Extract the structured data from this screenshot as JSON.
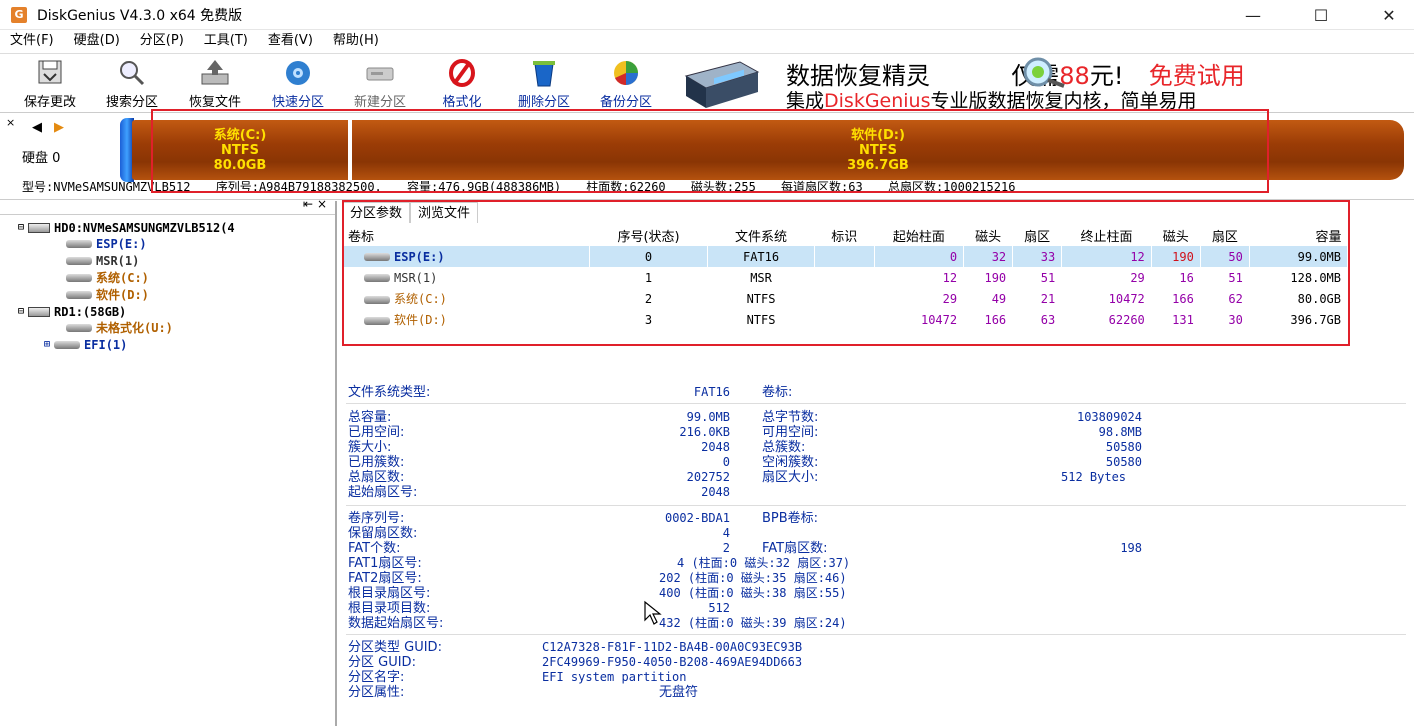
{
  "window": {
    "title": "DiskGenius V4.3.0 x64 免费版",
    "minimize": "—",
    "maximize": "☐",
    "close": "✕"
  },
  "menu": [
    "文件(F)",
    "硬盘(D)",
    "分区(P)",
    "工具(T)",
    "查看(V)",
    "帮助(H)"
  ],
  "toolbar": [
    "保存更改",
    "搜索分区",
    "恢复文件",
    "快速分区",
    "新建分区",
    "格式化",
    "删除分区",
    "备份分区"
  ],
  "ad": {
    "line1_a": "数据恢复精灵",
    "line1_b": "仅需",
    "line1_price": "88",
    "line1_c": "元!",
    "line1_free": "免费试用",
    "line2_a": "集成",
    "line2_brand": "DiskGenius",
    "line2_b": "专业版数据恢复内核，简单易用"
  },
  "diskbar": {
    "disk_label": "硬盘 0",
    "part_c": {
      "name": "系统(C:)",
      "fs": "NTFS",
      "size": "80.0GB"
    },
    "part_d": {
      "name": "软件(D:)",
      "fs": "NTFS",
      "size": "396.7GB"
    },
    "info": [
      "型号:NVMeSAMSUNGMZVLB512",
      "序列号:A984B79188382500.",
      "容量:476.9GB(488386MB)",
      "柱面数:62260",
      "磁头数:255",
      "每道扇区数:63",
      "总扇区数:1000215216"
    ]
  },
  "tree": {
    "disk0": "HD0:NVMeSAMSUNGMZVLB512(4",
    "disk0_parts": [
      "ESP(E:)",
      "MSR(1)",
      "系统(C:)",
      "软件(D:)"
    ],
    "disk1": "RD1:(58GB)",
    "disk1_parts": [
      "未格式化(U:)",
      "EFI(1)"
    ]
  },
  "tabs": [
    "分区参数",
    "浏览文件"
  ],
  "table": {
    "headers": [
      "卷标",
      "序号(状态)",
      "文件系统",
      "标识",
      "起始柱面",
      "磁头",
      "扇区",
      "终止柱面",
      "磁头",
      "扇区",
      "容量"
    ],
    "rows": [
      [
        "ESP(E:)",
        "0",
        "FAT16",
        "",
        "0",
        "32",
        "33",
        "12",
        "190",
        "50",
        "99.0MB"
      ],
      [
        "MSR(1)",
        "1",
        "MSR",
        "",
        "12",
        "190",
        "51",
        "29",
        "16",
        "51",
        "128.0MB"
      ],
      [
        "系统(C:)",
        "2",
        "NTFS",
        "",
        "29",
        "49",
        "21",
        "10472",
        "166",
        "62",
        "80.0GB"
      ],
      [
        "软件(D:)",
        "3",
        "NTFS",
        "",
        "10472",
        "166",
        "63",
        "62260",
        "131",
        "30",
        "396.7GB"
      ]
    ]
  },
  "details": {
    "fs_type_label": "文件系统类型:",
    "fs_type": "FAT16",
    "vol_label": "卷标:",
    "left1": [
      [
        "总容量:",
        "99.0MB"
      ],
      [
        "已用空间:",
        "216.0KB"
      ],
      [
        "簇大小:",
        "2048"
      ],
      [
        "已用簇数:",
        "0"
      ],
      [
        "总扇区数:",
        "202752"
      ],
      [
        "起始扇区号:",
        "2048"
      ]
    ],
    "right1": [
      [
        "总字节数:",
        "103809024"
      ],
      [
        "可用空间:",
        "98.8MB"
      ],
      [
        "总簇数:",
        "50580"
      ],
      [
        "空闲簇数:",
        "50580"
      ],
      [
        "扇区大小:",
        "512 Bytes"
      ]
    ],
    "left2": [
      [
        "卷序列号:",
        "0002-BDA1"
      ],
      [
        "保留扇区数:",
        "4"
      ],
      [
        "FAT个数:",
        "2"
      ],
      [
        "FAT1扇区号:",
        "4 (柱面:0 磁头:32 扇区:37)"
      ],
      [
        "FAT2扇区号:",
        "202 (柱面:0 磁头:35 扇区:46)"
      ],
      [
        "根目录扇区号:",
        "400 (柱面:0 磁头:38 扇区:55)"
      ],
      [
        "根目录项目数:",
        "512"
      ],
      [
        "数据起始扇区号:",
        "432 (柱面:0 磁头:39 扇区:24)"
      ]
    ],
    "bpb_label": "BPB卷标:",
    "fat_sectors_label": "FAT扇区数:",
    "fat_sectors": "198",
    "guid": [
      [
        "分区类型 GUID:",
        "C12A7328-F81F-11D2-BA4B-00A0C93EC93B"
      ],
      [
        "分区 GUID:",
        "2FC49969-F950-4050-B208-469AE94DD663"
      ],
      [
        "分区名字:",
        "EFI system partition"
      ],
      [
        "分区属性:",
        "无盘符"
      ]
    ]
  }
}
